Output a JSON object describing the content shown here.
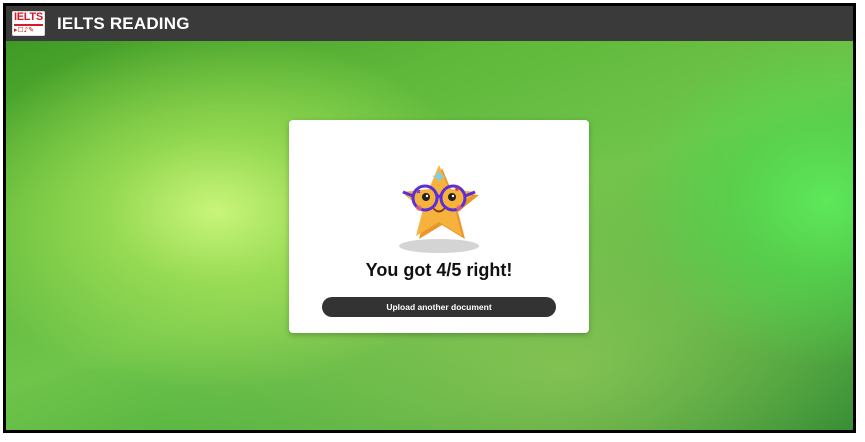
{
  "header": {
    "app_title": "IELTS READING",
    "logo_text": "IELTS",
    "logo_icons": "▸☐♪✎"
  },
  "result": {
    "message": "You got 4/5 right!",
    "score_correct": 4,
    "score_total": 5,
    "mascot_icon": "star-with-glasses-icon"
  },
  "actions": {
    "upload_label": "Upload another document"
  },
  "colors": {
    "topbar": "#3a3a3a",
    "button": "#333333",
    "star": "#f5b03c",
    "glasses": "#5a2ed8",
    "background_primary": "#6fc44a",
    "logo_red": "#d7192b"
  }
}
